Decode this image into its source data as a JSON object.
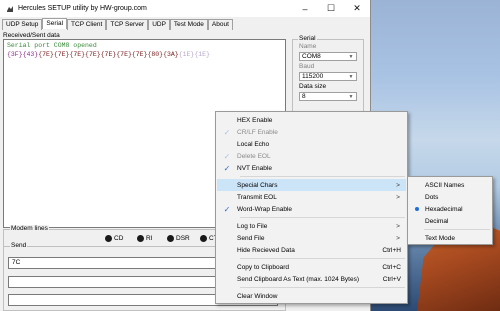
{
  "window": {
    "title": "Hercules SETUP utility by HW-group.com",
    "minimize": "–",
    "maximize": "☐",
    "close": "✕"
  },
  "tabs": [
    "UDP Setup",
    "Serial",
    "TCP Client",
    "TCP Server",
    "UDP",
    "Test Mode",
    "About"
  ],
  "terminal": {
    "label": "Received/Sent data",
    "line1": "Serial port COM8 opened",
    "hex_tokens": [
      {
        "text": "{3F}",
        "color": "purple"
      },
      {
        "text": "{43}",
        "color": "purple"
      },
      {
        "text": "{7E}",
        "color": "maroon"
      },
      {
        "text": "{7E}",
        "color": "maroon"
      },
      {
        "text": "{7E}",
        "color": "maroon"
      },
      {
        "text": "{7E}",
        "color": "maroon"
      },
      {
        "text": "{7E}",
        "color": "maroon"
      },
      {
        "text": "{7E}",
        "color": "maroon"
      },
      {
        "text": "{7E}",
        "color": "maroon"
      },
      {
        "text": "{80}",
        "color": "maroon"
      },
      {
        "text": "{3A}",
        "color": "maroon"
      },
      {
        "text": "{1E}",
        "color": "grey"
      },
      {
        "text": "{1E}",
        "color": "grey"
      }
    ]
  },
  "serial": {
    "group_label": "Serial",
    "name_label": "Name",
    "name_value": "COM8",
    "baud_label": "Baud",
    "baud_value": "115200",
    "data_size_label": "Data size",
    "data_size_value": "8"
  },
  "modem": {
    "label": "Modem lines",
    "leds": [
      "CD",
      "RI",
      "DSR",
      "CT"
    ]
  },
  "send": {
    "label": "Send",
    "input1": "7C",
    "input2": "",
    "input3": ""
  },
  "context_menu": {
    "hex_enable": "HEX Enable",
    "crlf_enable": "CR/LF Enable",
    "local_echo": "Local Echo",
    "delete_eol": "Delete EOL",
    "nvt_enable": "NVT Enable",
    "special_chars": "Special Chars",
    "transmit_eol": "Transmit EOL",
    "word_wrap": "Word-Wrap Enable",
    "log_to_file": "Log to File",
    "send_file": "Send File",
    "hide_received": "Hide Recieved Data",
    "hide_received_shortcut": "Ctrl+H",
    "copy_clipboard": "Copy to Clipboard",
    "copy_clipboard_shortcut": "Ctrl+C",
    "send_clipboard": "Send Clipboard As Text (max. 1024 Bytes)",
    "send_clipboard_shortcut": "Ctrl+V",
    "clear_window": "Clear Window",
    "submenu_arrow": ">"
  },
  "special_chars_submenu": {
    "ascii_names": "ASCII Names",
    "dots": "Dots",
    "hexadecimal": "Hexadecimal",
    "decimal": "Decimal",
    "text_mode": "Text Mode",
    "selected": "Hexadecimal"
  },
  "colors": {
    "highlight": "#cce4f7",
    "check": "#2a6fd0",
    "radio": "#1f6fd8"
  }
}
